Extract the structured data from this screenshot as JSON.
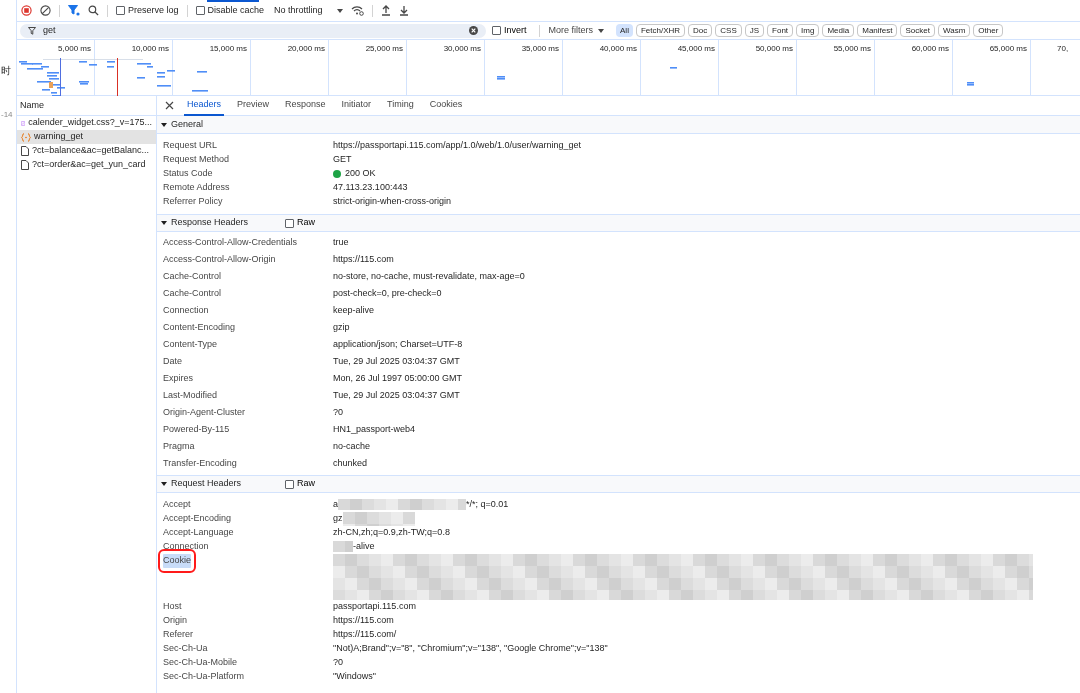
{
  "left_edge": [
    "时",
    "-14"
  ],
  "toolbar": {
    "recording": true,
    "filter_active": true,
    "preserve_log": {
      "label": "Preserve log",
      "checked": false
    },
    "disable_cache": {
      "label": "Disable cache",
      "checked": false
    },
    "throttling": "No throttling"
  },
  "filter_bar": {
    "value": "get",
    "invert": {
      "label": "Invert",
      "checked": false
    },
    "more_filters": "More filters",
    "types": [
      {
        "label": "All",
        "selected": true
      },
      {
        "label": "Fetch/XHR",
        "selected": false
      },
      {
        "label": "Doc",
        "selected": false
      },
      {
        "label": "CSS",
        "selected": false
      },
      {
        "label": "JS",
        "selected": false
      },
      {
        "label": "Font",
        "selected": false
      },
      {
        "label": "Img",
        "selected": false
      },
      {
        "label": "Media",
        "selected": false
      },
      {
        "label": "Manifest",
        "selected": false
      },
      {
        "label": "Socket",
        "selected": false
      },
      {
        "label": "Wasm",
        "selected": false
      },
      {
        "label": "Other",
        "selected": false
      }
    ]
  },
  "timeline": {
    "ticks": [
      "5,000 ms",
      "10,000 ms",
      "15,000 ms",
      "20,000 ms",
      "25,000 ms",
      "30,000 ms",
      "35,000 ms",
      "40,000 ms",
      "45,000 ms",
      "50,000 ms",
      "55,000 ms",
      "60,000 ms",
      "65,000 ms",
      "70,"
    ]
  },
  "requests": {
    "header": "Name",
    "items": [
      {
        "name": "calender_widget.css?_v=175...",
        "kind": "css",
        "selected": false
      },
      {
        "name": "warning_get",
        "kind": "xhr",
        "selected": true
      },
      {
        "name": "?ct=balance&ac=getBalanc...",
        "kind": "doc",
        "selected": false
      },
      {
        "name": "?ct=order&ac=get_yun_card",
        "kind": "doc",
        "selected": false
      }
    ]
  },
  "detail_tabs": [
    {
      "label": "Headers",
      "selected": true
    },
    {
      "label": "Preview",
      "selected": false
    },
    {
      "label": "Response",
      "selected": false
    },
    {
      "label": "Initiator",
      "selected": false
    },
    {
      "label": "Timing",
      "selected": false
    },
    {
      "label": "Cookies",
      "selected": false
    }
  ],
  "sections": [
    {
      "title": "General",
      "expanded": true,
      "rows": [
        {
          "name": "Request URL",
          "value": "https://passportapi.115.com/app/1.0/web/1.0/user/warning_get"
        },
        {
          "name": "Request Method",
          "value": "GET"
        },
        {
          "name": "Status Code",
          "value": "200 OK",
          "ok": true
        },
        {
          "name": "Remote Address",
          "value": "47.113.23.100:443"
        },
        {
          "name": "Referrer Policy",
          "value": "strict-origin-when-cross-origin"
        }
      ]
    },
    {
      "title": "Response Headers",
      "expanded": true,
      "raw": {
        "label": "Raw",
        "checked": false
      },
      "rows": [
        {
          "name": "Access-Control-Allow-Credentials",
          "value": "true"
        },
        {
          "name": "Access-Control-Allow-Origin",
          "value": "https://115.com"
        },
        {
          "name": "Cache-Control",
          "value": "no-store, no-cache, must-revalidate, max-age=0"
        },
        {
          "name": "Cache-Control",
          "value": "post-check=0, pre-check=0"
        },
        {
          "name": "Connection",
          "value": "keep-alive"
        },
        {
          "name": "Content-Encoding",
          "value": "gzip"
        },
        {
          "name": "Content-Type",
          "value": "application/json; Charset=UTF-8"
        },
        {
          "name": "Date",
          "value": "Tue, 29 Jul 2025 03:04:37 GMT"
        },
        {
          "name": "Expires",
          "value": "Mon, 26 Jul 1997 05:00:00 GMT"
        },
        {
          "name": "Last-Modified",
          "value": "Tue, 29 Jul 2025 03:04:37 GMT"
        },
        {
          "name": "Origin-Agent-Cluster",
          "value": "?0"
        },
        {
          "name": "Powered-By-115",
          "value": "HN1_passport-web4"
        },
        {
          "name": "Pragma",
          "value": "no-cache"
        },
        {
          "name": "Transfer-Encoding",
          "value": "chunked"
        }
      ]
    },
    {
      "title": "Request Headers",
      "expanded": true,
      "raw": {
        "label": "Raw",
        "checked": false
      },
      "rows": [
        {
          "name": "Accept",
          "value": "a",
          "redacted": true,
          "value_after": "*/*; q=0.01"
        },
        {
          "name": "Accept-Encoding",
          "value": "gz",
          "redacted": true
        },
        {
          "name": "Accept-Language",
          "value": "zh-CN,zh;q=0.9,zh-TW;q=0.8"
        },
        {
          "name": "Connection",
          "redacted": true,
          "value_after": "-alive"
        },
        {
          "name": "Cookie",
          "redacted": true,
          "highlighted": true
        },
        {
          "name": "Host",
          "value": "passportapi.115.com"
        },
        {
          "name": "Origin",
          "value": "https://115.com"
        },
        {
          "name": "Referer",
          "value": "https://115.com/"
        },
        {
          "name": "Sec-Ch-Ua",
          "value": "\"Not)A;Brand\";v=\"8\", \"Chromium\";v=\"138\", \"Google Chrome\";v=\"138\""
        },
        {
          "name": "Sec-Ch-Ua-Mobile",
          "value": "?0"
        },
        {
          "name": "Sec-Ch-Ua-Platform",
          "value": "\"Windows\""
        }
      ]
    }
  ]
}
